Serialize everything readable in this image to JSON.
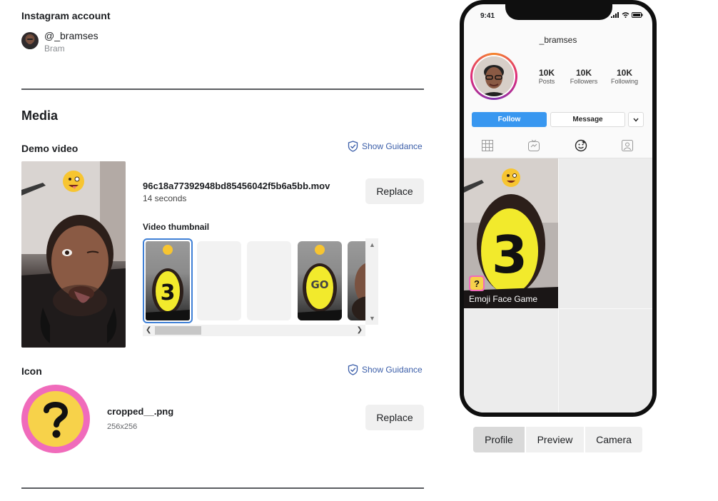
{
  "account": {
    "section_title": "Instagram account",
    "handle": "@_bramses",
    "name": "Bram"
  },
  "media": {
    "title": "Media",
    "demo_video": {
      "label": "Demo video",
      "guidance": "Show Guidance",
      "filename": "96c18a77392948bd85456042f5b6a5bb.mov",
      "duration": "14 seconds",
      "replace": "Replace",
      "thumbnail_label": "Video thumbnail"
    },
    "icon": {
      "label": "Icon",
      "guidance": "Show Guidance",
      "filename": "cropped__.png",
      "dimensions": "256x256",
      "replace": "Replace"
    }
  },
  "phone": {
    "time": "9:41",
    "username": "_bramses",
    "stats": [
      {
        "value": "10K",
        "label": "Posts"
      },
      {
        "value": "10K",
        "label": "Followers"
      },
      {
        "value": "10K",
        "label": "Following"
      }
    ],
    "follow": "Follow",
    "message": "Message",
    "effect_name": "Emoji Face Game",
    "colors": {
      "follow": "#3897f0",
      "icon_pink": "#f06bbb",
      "icon_yellow": "#f7d24a"
    }
  },
  "preview_tabs": [
    "Profile",
    "Preview",
    "Camera"
  ]
}
